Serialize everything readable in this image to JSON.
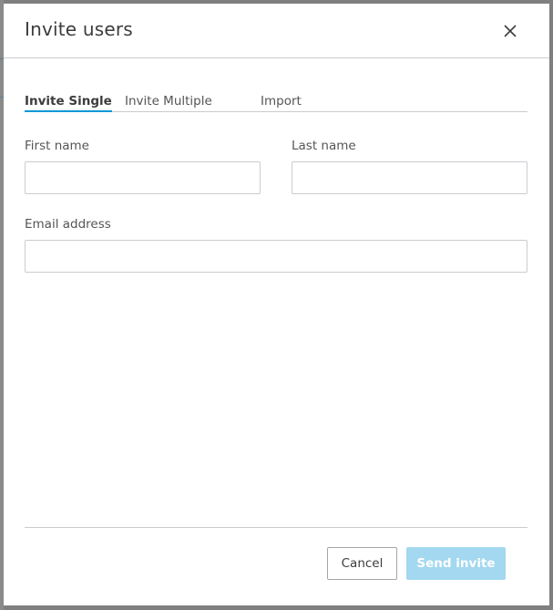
{
  "dialog": {
    "title": "Invite users",
    "close_icon": "close-icon"
  },
  "tabs": [
    {
      "label": "Invite Single",
      "active": true
    },
    {
      "label": "Invite Multiple",
      "active": false
    },
    {
      "label": "Import",
      "active": false
    }
  ],
  "form": {
    "first_name": {
      "label": "First name",
      "value": "",
      "placeholder": ""
    },
    "last_name": {
      "label": "Last name",
      "value": "",
      "placeholder": ""
    },
    "email": {
      "label": "Email address",
      "value": "",
      "placeholder": ""
    }
  },
  "footer": {
    "cancel_label": "Cancel",
    "send_label": "Send invite",
    "send_disabled": true
  },
  "colors": {
    "accent": "#0696d7",
    "send_disabled_bg": "#a3d8f0",
    "border": "#c9ccd0",
    "text": "#3c3c3c",
    "overlay": "#7f7f7f"
  }
}
